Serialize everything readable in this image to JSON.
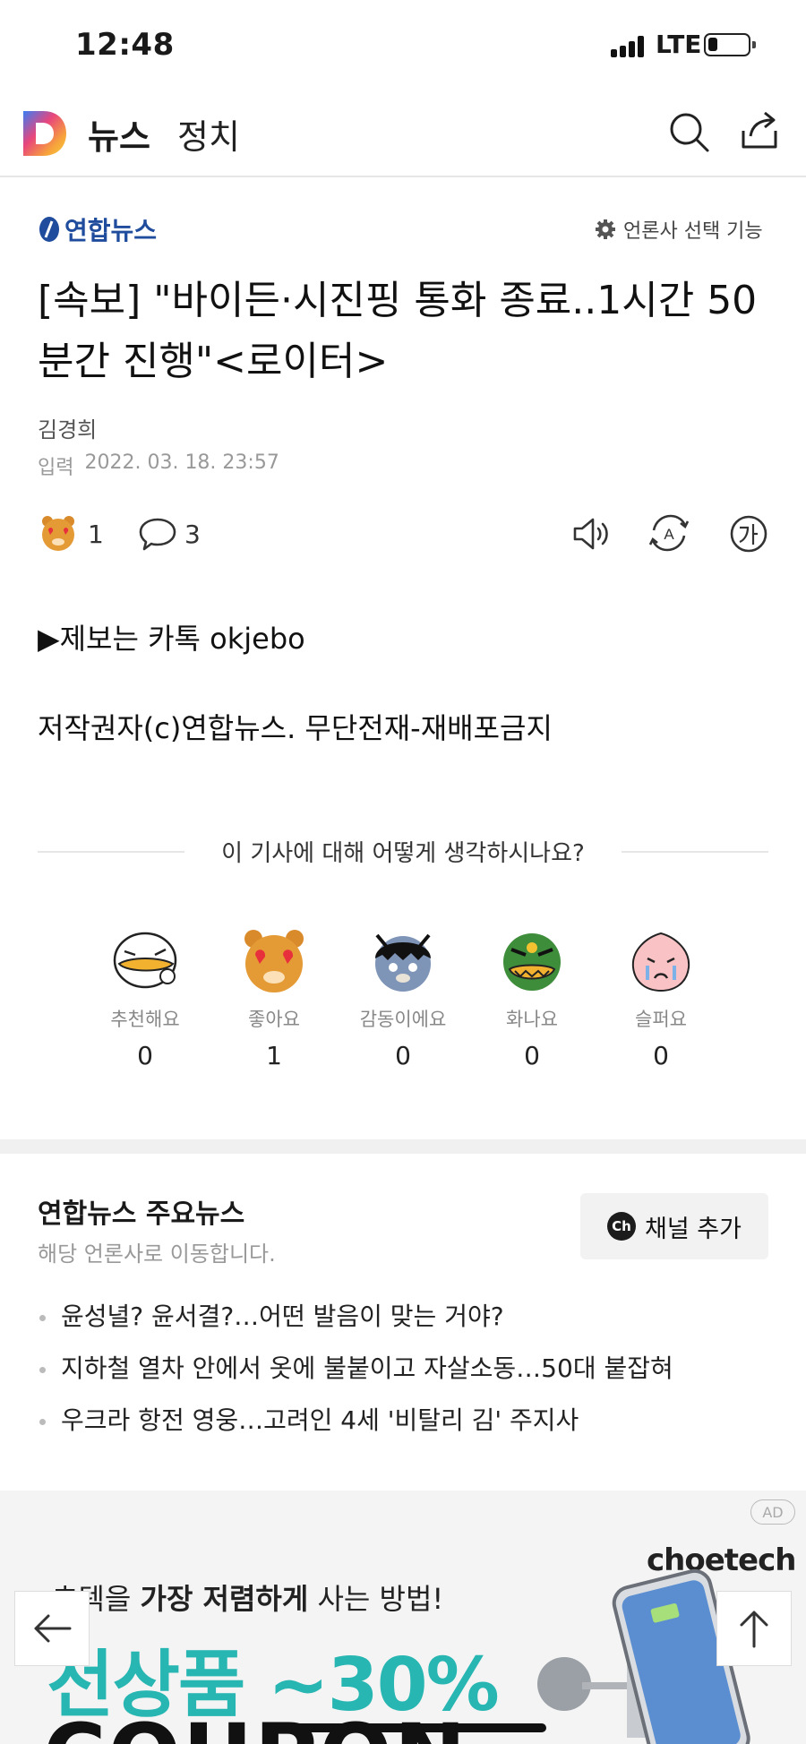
{
  "status_bar": {
    "time": "12:48",
    "network": "LTE"
  },
  "nav": {
    "title": "뉴스",
    "section": "정치",
    "icons": [
      "search-icon",
      "share-icon"
    ]
  },
  "article": {
    "press_name": "연합뉴스",
    "press_select_label": "언론사 선택 기능",
    "headline": "[속보] \"바이든·시진핑 통화 종료..1시간 50분간 진행\"<로이터>",
    "reporter": "김경희",
    "date_label": "입력",
    "date_value": "2022. 03. 18. 23:57",
    "like_count": "1",
    "comment_count": "3",
    "body": [
      "▶제보는 카톡 okjebo",
      "저작권자(c)연합뉴스. 무단전재-재배포금지"
    ]
  },
  "reactions": {
    "title": "이 기사에 대해 어떻게 생각하시나요?",
    "items": [
      {
        "label": "추천해요",
        "count": "0"
      },
      {
        "label": "좋아요",
        "count": "1"
      },
      {
        "label": "감동이에요",
        "count": "0"
      },
      {
        "label": "화나요",
        "count": "0"
      },
      {
        "label": "슬퍼요",
        "count": "0"
      }
    ]
  },
  "main_news": {
    "title": "연합뉴스 주요뉴스",
    "subtitle": "해당 언론사로 이동합니다.",
    "channel_button": "채널 추가",
    "channel_badge": "Ch",
    "items": [
      "윤성녈? 윤서결?…어떤 발음이 맞는 거야?",
      "지하철 열차 안에서 옷에 불붙이고 자살소동…50대 붙잡혀",
      "우크라 항전 영웅…고려인 4세 '비탈리 김' 주지사"
    ]
  },
  "ad": {
    "badge": "AD",
    "brand": "choetech",
    "line1_pre": "초텍을 ",
    "line1_bold": "가장 저렴하게",
    "line1_post": " 사는 방법!",
    "line2": "전상품 ~30%",
    "line3": "COUPON"
  },
  "colors": {
    "press_blue": "#1f4c9c",
    "ad_teal": "#27b6b2",
    "divider": "#e6e6e6"
  }
}
